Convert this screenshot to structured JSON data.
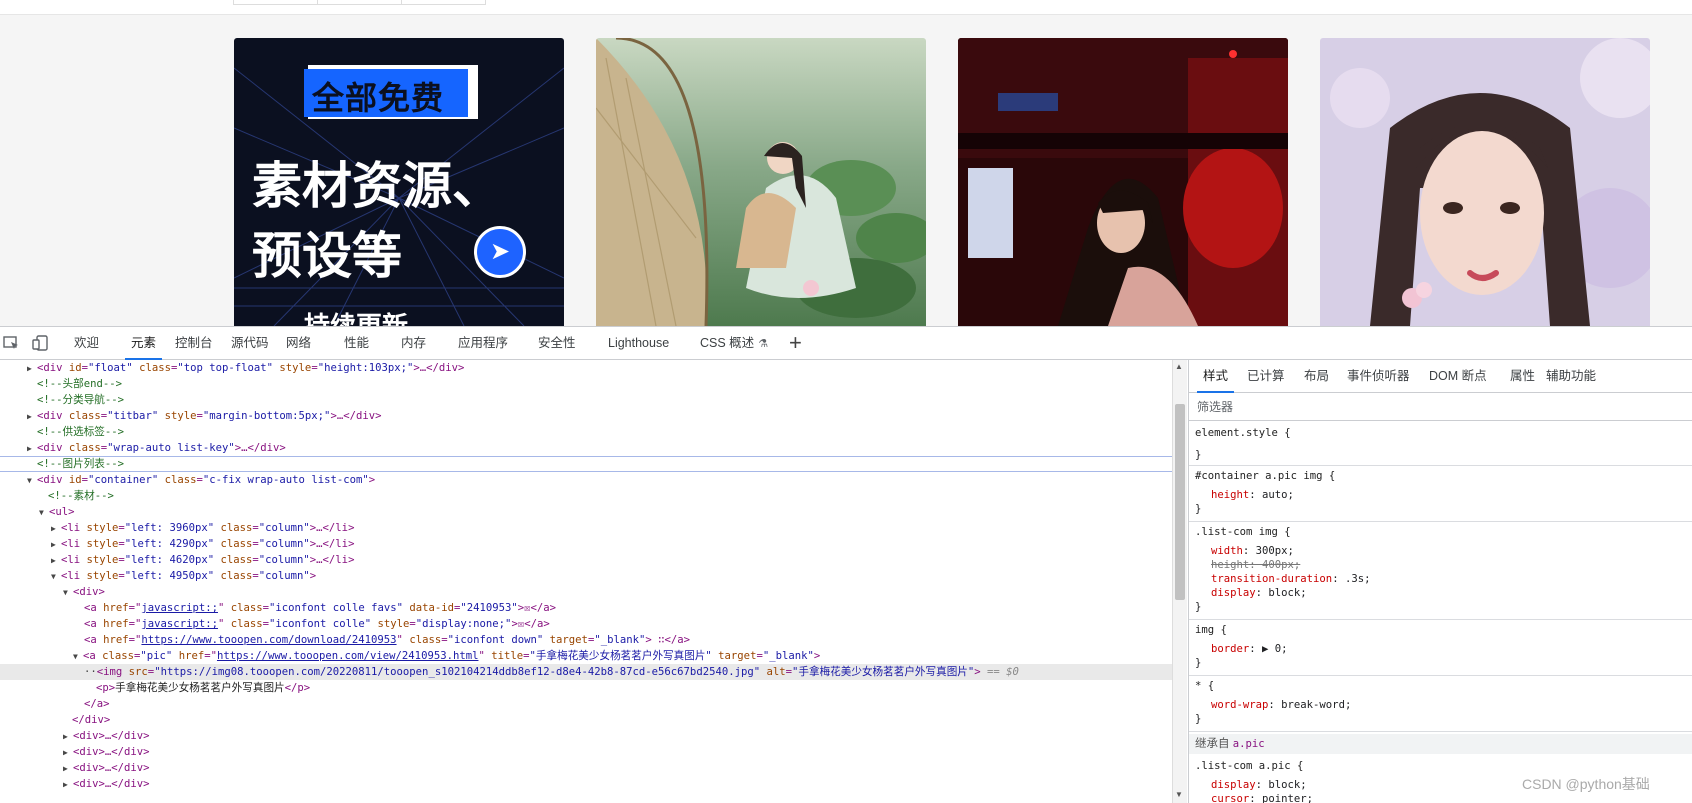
{
  "gallery": {
    "cards": [
      {
        "headline": "全部免费",
        "big1": "素材资源、",
        "big2": "预设等",
        "footer": "持续更新"
      },
      {
        "alt": "lotus girl"
      },
      {
        "alt": "night girl"
      },
      {
        "alt": "portrait girl"
      }
    ]
  },
  "devtools": {
    "tabs": [
      "欢迎",
      "元素",
      "控制台",
      "源代码",
      "网络",
      "性能",
      "内存",
      "应用程序",
      "安全性",
      "Lighthouse",
      "CSS 概述"
    ],
    "active_tab": "元素",
    "plus": "+"
  },
  "dom": {
    "r1": {
      "tag": "<div ",
      "a1": "id",
      "v1": "\"float\"",
      "a2": " class",
      "v2": "\"top top-float\"",
      "a3": " style",
      "v3": "\"height:103px;\"",
      "end": ">…</div>"
    },
    "r2": "<!--头部end-->",
    "r3": "<!--分类导航-->",
    "r4": {
      "tag": "<div ",
      "a1": "class",
      "v1": "\"titbar\"",
      "a2": " style",
      "v2": "\"margin-bottom:5px;\"",
      "end": ">…</div>"
    },
    "r5": "<!--供选标签-->",
    "r6": {
      "tag": "<div ",
      "a1": "class",
      "v1": "\"wrap-auto list-key\"",
      "end": ">…</div>"
    },
    "r7": "<!--图片列表-->",
    "r8": {
      "tag": "<div ",
      "a1": "id",
      "v1": "\"container\"",
      "a2": " class",
      "v2": "\"c-fix wrap-auto list-com\"",
      "end": ">"
    },
    "r9": "<!--素材-->",
    "r10": "<ul>",
    "li": [
      {
        "a1": "style",
        "v1": "\"left: 3960px\"",
        "a2": " class",
        "v2": "\"column\"",
        "end": ">…</li>"
      },
      {
        "a1": "style",
        "v1": "\"left: 4290px\"",
        "a2": " class",
        "v2": "\"column\"",
        "end": ">…</li>"
      },
      {
        "a1": "style",
        "v1": "\"left: 4620px\"",
        "a2": " class",
        "v2": "\"column\"",
        "end": ">…</li>"
      },
      {
        "a1": "style",
        "v1": "\"left: 4950px\"",
        "a2": " class",
        "v2": "\"column\"",
        "end": ">"
      }
    ],
    "r15": "<div>",
    "r16": {
      "a1": "href",
      "v1": "javascript:;",
      "a2": " class",
      "v2": "\"iconfont colle favs\"",
      "a3": " data-id",
      "v3": "\"2410953\"",
      "end": ">☒</a>"
    },
    "r17": {
      "a1": "href",
      "v1": "javascript:;",
      "a2": " class",
      "v2": "\"iconfont colle\"",
      "a3": " style",
      "v3": "\"display:none;\"",
      "end": ">☒</a>"
    },
    "r18": {
      "a1": "href",
      "v1": "https://www.tooopen.com/download/2410953",
      "a2": " class",
      "v2": "\"iconfont down\"",
      "a3": " target",
      "v3": "\"_blank\"",
      "end": "> ∷</a>"
    },
    "r19": {
      "a1": "class",
      "v1": "\"pic\"",
      "a2": " href",
      "v2": "https://www.tooopen.com/view/2410953.html",
      "a3": " title",
      "v3": "\"手拿梅花美少女杨茗茗户外写真图片\"",
      "a4": " target",
      "v4": "\"_blank\"",
      "end": ">"
    },
    "r20": {
      "a1": "src",
      "v1": "\"https://img08.tooopen.com/20220811/tooopen_s102104214ddb8ef12-d8e4-42b8-87cd-e56c67bd2540.jpg\"",
      "a2": " alt",
      "v2": "\"手拿梅花美少女杨茗茗户外写真图片\"",
      "end": ">",
      "eq": " == $0"
    },
    "r21": {
      "text": "手拿梅花美少女杨茗茗户外写真图片"
    },
    "r22": "</a>",
    "r23": "</div>",
    "collapsed": [
      "<div>…</div>",
      "<div>…</div>",
      "<div>…</div>",
      "<div>…</div>"
    ]
  },
  "styles": {
    "tabs": [
      "样式",
      "已计算",
      "布局",
      "事件侦听器",
      "DOM 断点",
      "属性",
      "辅助功能"
    ],
    "active_tab": "样式",
    "filter_placeholder": "筛选器",
    "rules": {
      "element_style": "element.style {",
      "close": "}",
      "r1_sel": "#container a.pic img {",
      "r1_p1n": "height",
      "r1_p1v": ": auto;",
      "r2_sel": ".list-com img {",
      "r2_p1n": "width",
      "r2_p1v": ": 300px;",
      "r2_p2n": "height: 400px;",
      "r2_p3n": "transition-duration",
      "r2_p3v": ": .3s;",
      "r2_p4n": "display",
      "r2_p4v": ": block;",
      "r3_sel": "img {",
      "r3_p1n": "border",
      "r3_p1v": ": ▶ 0;",
      "r4_sel": "* {",
      "r4_p1n": "word-wrap",
      "r4_p1v": ": break-word;",
      "inherited_label": "继承自",
      "inherited_target": "a.pic",
      "r5_sel": ".list-com a.pic {",
      "r5_p1n": "display",
      "r5_p1v": ": block;",
      "r5_p2n": "cursor",
      "r5_p2v": ": pointer;"
    }
  },
  "watermark": "CSDN @python基础",
  "colors": {
    "accent": "#1a73e8",
    "tag": "#881280",
    "attr_name": "#994500",
    "attr_value": "#1a1aa6",
    "comment": "#236e25"
  }
}
